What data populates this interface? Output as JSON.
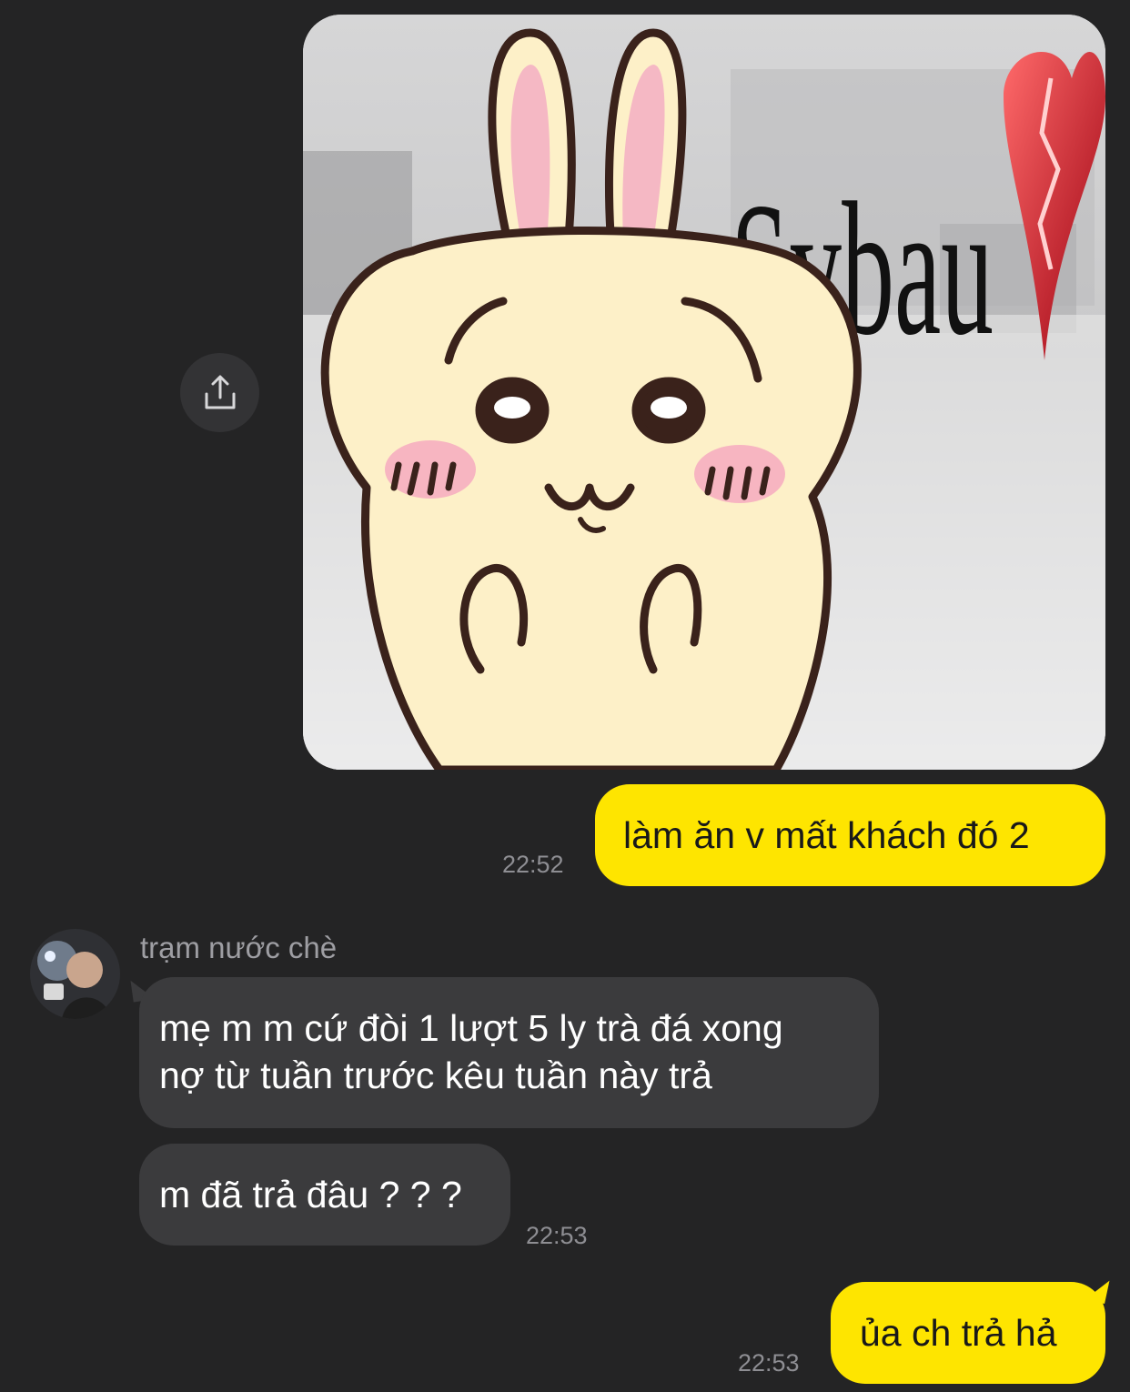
{
  "messages": [
    {
      "direction": "out",
      "type": "sticker",
      "sticker": {
        "caption": "Sybau"
      }
    },
    {
      "direction": "out",
      "type": "text",
      "text": "làm ăn v mất khách đó 2",
      "time": "22:52"
    },
    {
      "direction": "in",
      "type": "text",
      "sender": "trạm nước chè",
      "lines": [
        "mẹ m m cứ đòi 1 lượt 5 ly trà đá xong",
        "nợ từ tuần trước kêu tuần này trả"
      ]
    },
    {
      "direction": "in",
      "type": "text",
      "text": "m đã trả đâu ? ? ?",
      "time": "22:53"
    },
    {
      "direction": "out",
      "type": "text",
      "text": "ủa ch trả hả",
      "time": "22:53"
    }
  ],
  "icons": {
    "share": "share-icon",
    "avatar": "avatar"
  },
  "colors": {
    "background": "#242425",
    "outgoing_bubble": "#fee500",
    "incoming_bubble": "#3b3b3d",
    "timestamp": "#8e8e93",
    "sender_name": "#9e9ea3"
  }
}
